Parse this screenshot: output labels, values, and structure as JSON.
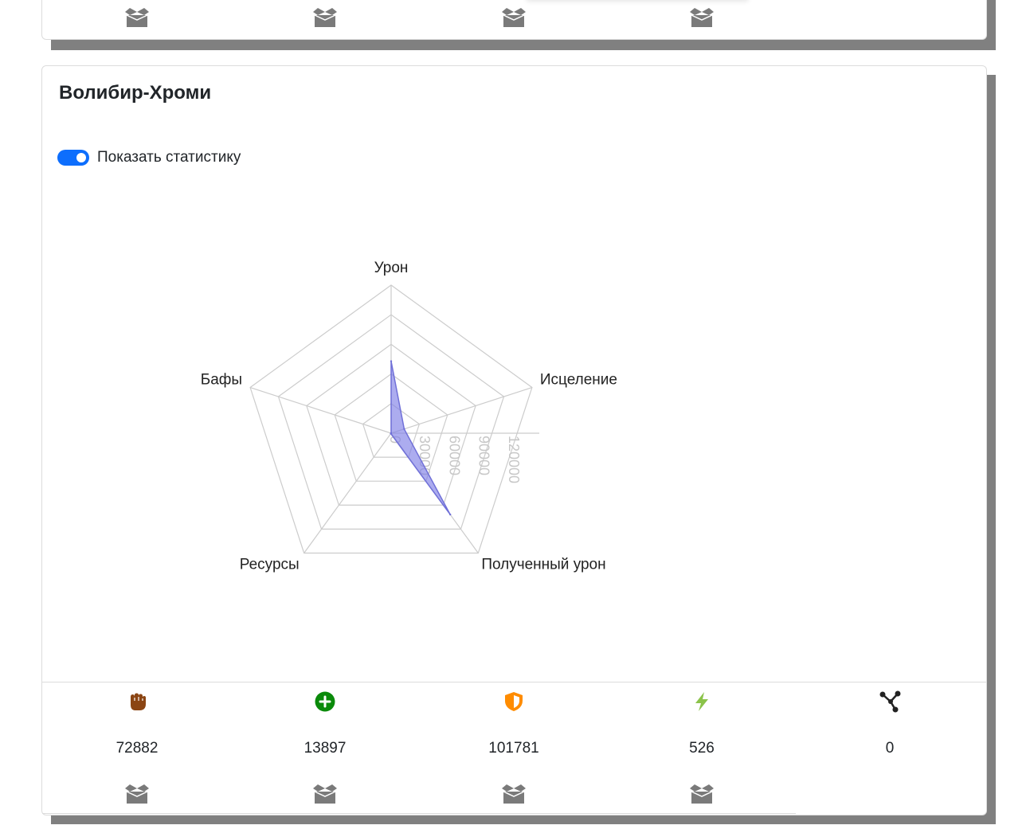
{
  "colors": {
    "accent": "#0d6efd",
    "radar_fill": "#8080e6",
    "radar_stroke": "#7070d8",
    "grid": "#cccccc",
    "box_icon": "#7a7a7a",
    "damage_icon": "#8b4513",
    "heal_icon": "#0a8a0a",
    "taken_icon": "#ff8c00",
    "resource_icon": "#8bc34a",
    "buff_icon": "#222222",
    "card_shadow": "#808080"
  },
  "top_card": {
    "icons": [
      "box-icon",
      "box-icon",
      "box-icon",
      "box-icon"
    ]
  },
  "card": {
    "title": "Волибир-Хроми",
    "toggle": {
      "label": "Показать статистику",
      "checked": true
    }
  },
  "chart_data": {
    "type": "radar",
    "axes": [
      "Урон",
      "Исцеление",
      "Полученный урон",
      "Ресурсы",
      "Бафы"
    ],
    "series": [
      {
        "values": [
          72882,
          13897,
          101781,
          526,
          0
        ]
      }
    ],
    "rlim": [
      0,
      150000
    ],
    "ticks": [
      0,
      30000,
      60000,
      90000,
      120000
    ],
    "tick_labels": [
      "0",
      "30000",
      "60000",
      "90000",
      "120000"
    ],
    "grid": true
  },
  "stats": [
    {
      "icon": "fist-icon",
      "value": "72882"
    },
    {
      "icon": "plus-circle-icon",
      "value": "13897"
    },
    {
      "icon": "shield-icon",
      "value": "101781"
    },
    {
      "icon": "bolt-icon",
      "value": "526"
    },
    {
      "icon": "share-nodes-icon",
      "value": "0"
    }
  ],
  "footer_icons": [
    "box-icon",
    "box-icon",
    "box-icon",
    "box-icon"
  ]
}
